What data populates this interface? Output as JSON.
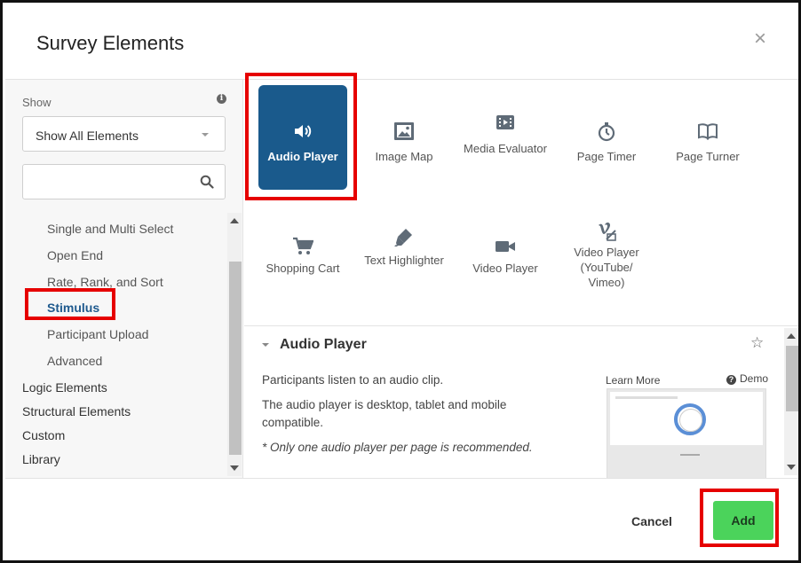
{
  "dialog": {
    "title": "Survey Elements",
    "close_icon": "close-icon"
  },
  "sidebar": {
    "show_label": "Show",
    "filter_selected": "Show All Elements",
    "search_placeholder": "",
    "items": [
      {
        "label": "Single and Multi Select",
        "level": "sub"
      },
      {
        "label": "Open End",
        "level": "sub"
      },
      {
        "label": "Rate, Rank, and Sort",
        "level": "sub"
      },
      {
        "label": "Stimulus",
        "level": "sub",
        "active": true
      },
      {
        "label": "Participant Upload",
        "level": "sub"
      },
      {
        "label": "Advanced",
        "level": "sub"
      },
      {
        "label": "Logic Elements",
        "level": "top"
      },
      {
        "label": "Structural Elements",
        "level": "top"
      },
      {
        "label": "Custom",
        "level": "top"
      },
      {
        "label": "Library",
        "level": "top"
      }
    ]
  },
  "elements": [
    {
      "label": "Audio Player",
      "icon": "volume-icon",
      "selected": true
    },
    {
      "label": "Image Map",
      "icon": "image-icon"
    },
    {
      "label": "Media Evaluator",
      "icon": "media-icon"
    },
    {
      "label": "Page Timer",
      "icon": "stopwatch-icon"
    },
    {
      "label": "Page Turner",
      "icon": "book-icon"
    },
    {
      "label": "Shopping Cart",
      "icon": "cart-icon"
    },
    {
      "label": "Text Highlighter",
      "icon": "marker-icon"
    },
    {
      "label": "Video Player",
      "icon": "video-camera-icon"
    },
    {
      "label": "Video Player (YouTube/ Vimeo)",
      "icon": "vimeo-icon"
    }
  ],
  "detail": {
    "title": "Audio Player",
    "description": "Participants listen to an audio clip.",
    "compatibility": "The audio player is desktop, tablet and mobile compatible.",
    "note": "* Only one audio player per page is recommended.",
    "learn_more": "Learn More",
    "demo": "Demo"
  },
  "footer": {
    "cancel_label": "Cancel",
    "add_label": "Add"
  },
  "colors": {
    "selected_tile": "#1a5a8c",
    "add_button": "#4bd35b",
    "highlight": "#e60000",
    "active_nav": "#1f5a8e"
  }
}
